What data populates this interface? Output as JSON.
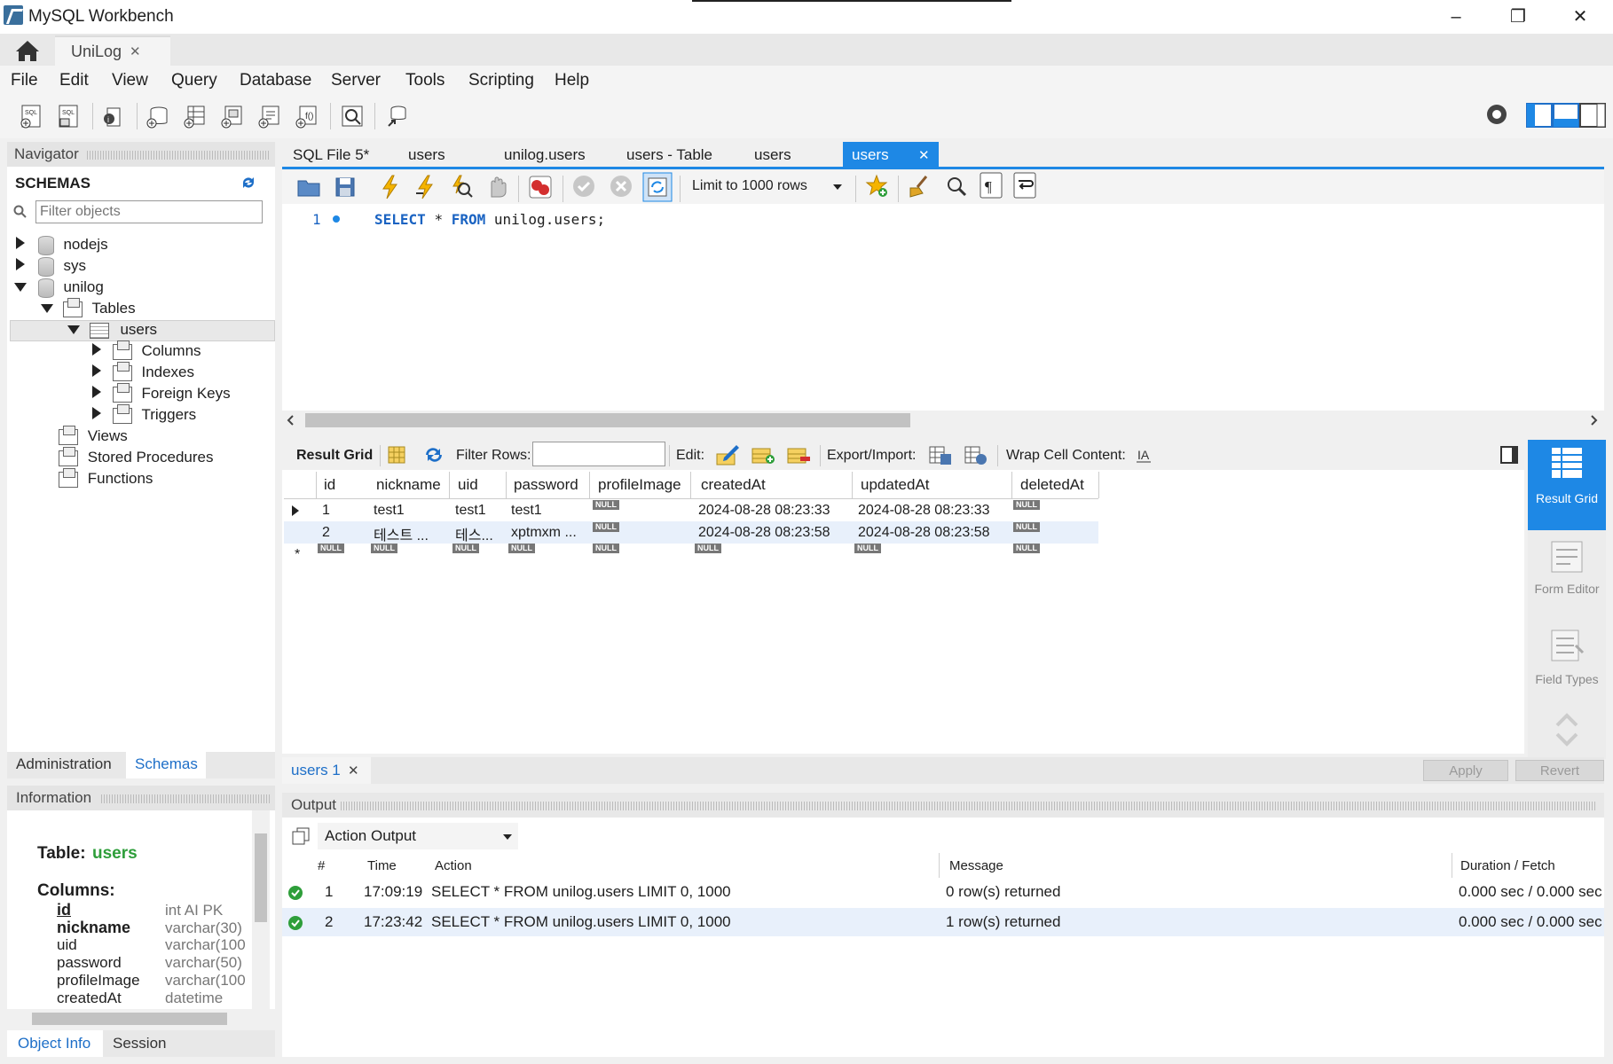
{
  "window": {
    "title": "MySQL Workbench",
    "minimize": "–",
    "restore": "❐",
    "close": "✕"
  },
  "conn_tab": {
    "label": "UniLog",
    "close": "✕"
  },
  "menu": [
    "File",
    "Edit",
    "View",
    "Query",
    "Database",
    "Server",
    "Tools",
    "Scripting",
    "Help"
  ],
  "navigator": {
    "title": "Navigator",
    "schemas_label": "SCHEMAS",
    "filter_placeholder": "Filter objects",
    "tree": {
      "nodejs": "nodejs",
      "sys": "sys",
      "unilog": "unilog",
      "tables": "Tables",
      "users": "users",
      "columns": "Columns",
      "indexes": "Indexes",
      "foreign_keys": "Foreign Keys",
      "triggers": "Triggers",
      "views": "Views",
      "stored_procedures": "Stored Procedures",
      "functions": "Functions"
    },
    "bottom_tabs": [
      "Administration",
      "Schemas"
    ]
  },
  "information": {
    "title": "Information",
    "table_label": "Table:",
    "table_name": "users",
    "columns_label": "Columns:",
    "columns": [
      {
        "name": "id",
        "type": "int AI PK"
      },
      {
        "name": "nickname",
        "type": "varchar(30)"
      },
      {
        "name": "uid",
        "type": "varchar(100"
      },
      {
        "name": "password",
        "type": "varchar(50)"
      },
      {
        "name": "profileImage",
        "type": "varchar(100"
      },
      {
        "name": "createdAt",
        "type": "datetime"
      }
    ],
    "bottom_tabs": [
      "Object Info",
      "Session"
    ]
  },
  "sql_tabs": [
    "SQL File 5*",
    "users",
    "unilog.users",
    "users - Table",
    "users",
    "users"
  ],
  "sql_tab_close": "✕",
  "query_toolbar": {
    "limit_label": "Limit to 1000 rows"
  },
  "editor": {
    "line_number": "1",
    "kw_select": "SELECT",
    "star": "*",
    "kw_from": "FROM",
    "target": "unilog.users;"
  },
  "result_toolbar": {
    "result_grid": "Result Grid",
    "filter_rows": "Filter Rows:",
    "edit": "Edit:",
    "export_import": "Export/Import:",
    "wrap_cell": "Wrap Cell Content:"
  },
  "grid": {
    "headers": [
      "id",
      "nickname",
      "uid",
      "password",
      "profileImage",
      "createdAt",
      "updatedAt",
      "deletedAt"
    ],
    "rows": [
      [
        "1",
        "test1",
        "test1",
        "test1",
        "NULL",
        "2024-08-28 08:23:33",
        "2024-08-28 08:23:33",
        "NULL"
      ],
      [
        "2",
        "테스트 ...",
        "테스...",
        "xptmxm ...",
        "NULL",
        "2024-08-28 08:23:58",
        "2024-08-28 08:23:58",
        "NULL"
      ]
    ],
    "new_row_marker": "*",
    "null": "NULL"
  },
  "right_rail": {
    "result_grid": "Result Grid",
    "form_editor": "Form Editor",
    "field_types": "Field Types"
  },
  "result_tab": {
    "label": "users 1",
    "close": "✕"
  },
  "actions": {
    "apply": "Apply",
    "revert": "Revert"
  },
  "output": {
    "title": "Output",
    "selector": "Action Output",
    "headers": [
      "#",
      "Time",
      "Action",
      "Message",
      "Duration / Fetch"
    ],
    "rows": [
      {
        "num": "1",
        "time": "17:09:19",
        "action": "SELECT * FROM unilog.users LIMIT 0, 1000",
        "message": "0 row(s) returned",
        "duration": "0.000 sec / 0.000 sec"
      },
      {
        "num": "2",
        "time": "17:23:42",
        "action": "SELECT * FROM unilog.users LIMIT 0, 1000",
        "message": "1 row(s) returned",
        "duration": "0.000 sec / 0.000 sec"
      }
    ]
  },
  "colors": {
    "accent": "#1e88e5",
    "tab_active": "#1e88e5",
    "success": "#2e9e3a",
    "keyword": "#1a63c2"
  }
}
